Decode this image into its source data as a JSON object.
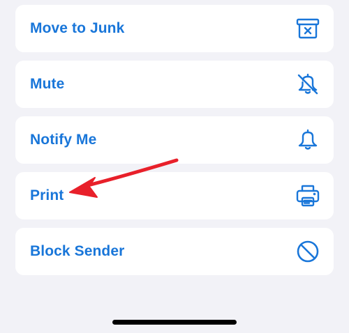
{
  "menu": {
    "items": [
      {
        "label": "Move to Junk",
        "icon": "junk-bin-icon"
      },
      {
        "label": "Mute",
        "icon": "bell-slash-icon"
      },
      {
        "label": "Notify Me",
        "icon": "bell-icon"
      },
      {
        "label": "Print",
        "icon": "printer-icon"
      },
      {
        "label": "Block Sender",
        "icon": "block-icon"
      }
    ]
  },
  "colors": {
    "background": "#f2f2f7",
    "card": "#ffffff",
    "accent": "#1976d9",
    "annotation_arrow": "#e8202a",
    "home_indicator": "#000000"
  }
}
